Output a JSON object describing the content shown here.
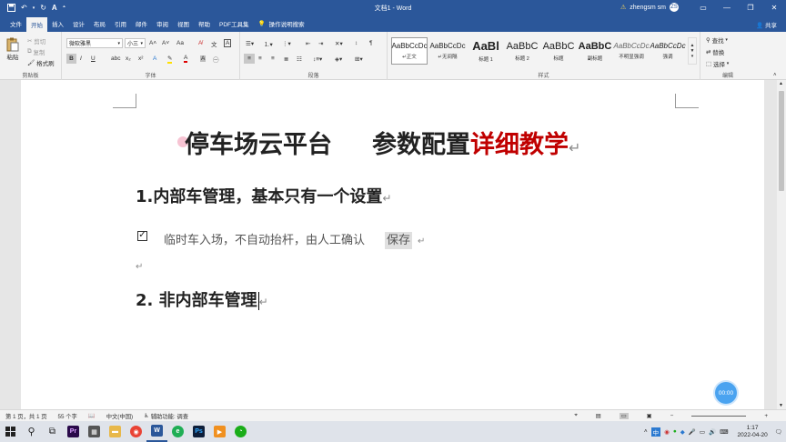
{
  "window": {
    "title": "文档1 - Word",
    "user": "zhengsm sm",
    "user_initials": "ZS"
  },
  "quick_access": [
    "save-icon",
    "undo-icon",
    "redo-icon",
    "autoformat-icon"
  ],
  "tabs": [
    {
      "label": "文件"
    },
    {
      "label": "开始"
    },
    {
      "label": "插入"
    },
    {
      "label": "设计"
    },
    {
      "label": "布局"
    },
    {
      "label": "引用"
    },
    {
      "label": "邮件"
    },
    {
      "label": "审阅"
    },
    {
      "label": "视图"
    },
    {
      "label": "帮助"
    },
    {
      "label": "PDF工具集"
    },
    {
      "label": "操作说明搜索"
    }
  ],
  "share_label": "共享",
  "ribbon": {
    "clipboard": {
      "paste": "粘贴",
      "cut": "剪切",
      "copy": "复制",
      "format_painter": "格式刷",
      "label": "剪贴板"
    },
    "font": {
      "font_name": "微软雅黑",
      "font_size": "小三",
      "label": "字体"
    },
    "paragraph": {
      "label": "段落"
    },
    "styles": {
      "items": [
        {
          "preview": "AaBbCcDc",
          "name": "↵正文"
        },
        {
          "preview": "AaBbCcDc",
          "name": "↵无间隔"
        },
        {
          "preview": "AaBl",
          "name": "标题 1"
        },
        {
          "preview": "AaBbC",
          "name": "标题 2"
        },
        {
          "preview": "AaBbC",
          "name": "标题"
        },
        {
          "preview": "AaBbC",
          "name": "副标题"
        },
        {
          "preview": "AaBbCcDc",
          "name": "不明显强调"
        },
        {
          "preview": "AaBbCcDc",
          "name": "强调"
        }
      ],
      "label": "样式"
    },
    "editing": {
      "find": "查找",
      "replace": "替换",
      "select": "选择",
      "label": "编辑"
    }
  },
  "document": {
    "title_part1": "停车场云平台",
    "title_part2": "参数配置",
    "title_part3": "详细教学",
    "heading1": "1.内部车管理，基本只有一个设置",
    "checkbox_text": "临时车入场，不自动抬杆，由人工确认",
    "save_label": "保存",
    "heading2": "2. 非内部车管理",
    "pilcrow": "↵"
  },
  "statusbar": {
    "page": "第 1 页，共 1 页",
    "words": "55 个字",
    "lang": "中文(中国)",
    "accessibility": "辅助功能: 调查"
  },
  "timer": "00:00",
  "clock": {
    "time": "1:17",
    "date": "2022-04-20"
  },
  "tray": {
    "ime": "中"
  },
  "colors": {
    "word_blue": "#2b579a",
    "title_red": "#c00000"
  }
}
